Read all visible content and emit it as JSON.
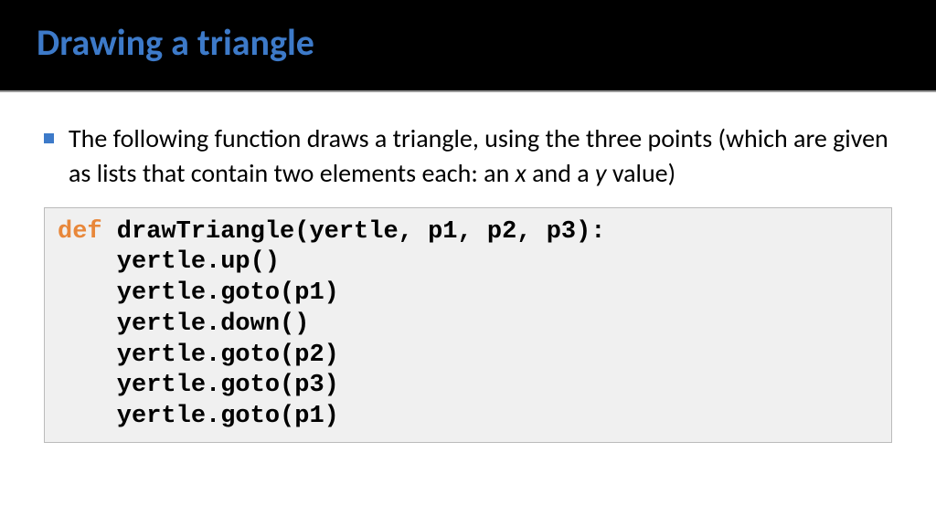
{
  "header": {
    "title": "Drawing a triangle"
  },
  "bullet": {
    "text_part1": "The following function draws a triangle, using the three points (which are given as lists that contain two elements each: an ",
    "italic_x": "x",
    "text_part2": " and a ",
    "italic_y": "y",
    "text_part3": " value)"
  },
  "code": {
    "keyword": "def",
    "line1_rest": " drawTriangle(yertle, p1, p2, p3):",
    "line2": "    yertle.up()",
    "line3": "    yertle.goto(p1)",
    "line4": "    yertle.down()",
    "line5": "    yertle.goto(p2)",
    "line6": "    yertle.goto(p3)",
    "line7": "    yertle.goto(p1)"
  }
}
